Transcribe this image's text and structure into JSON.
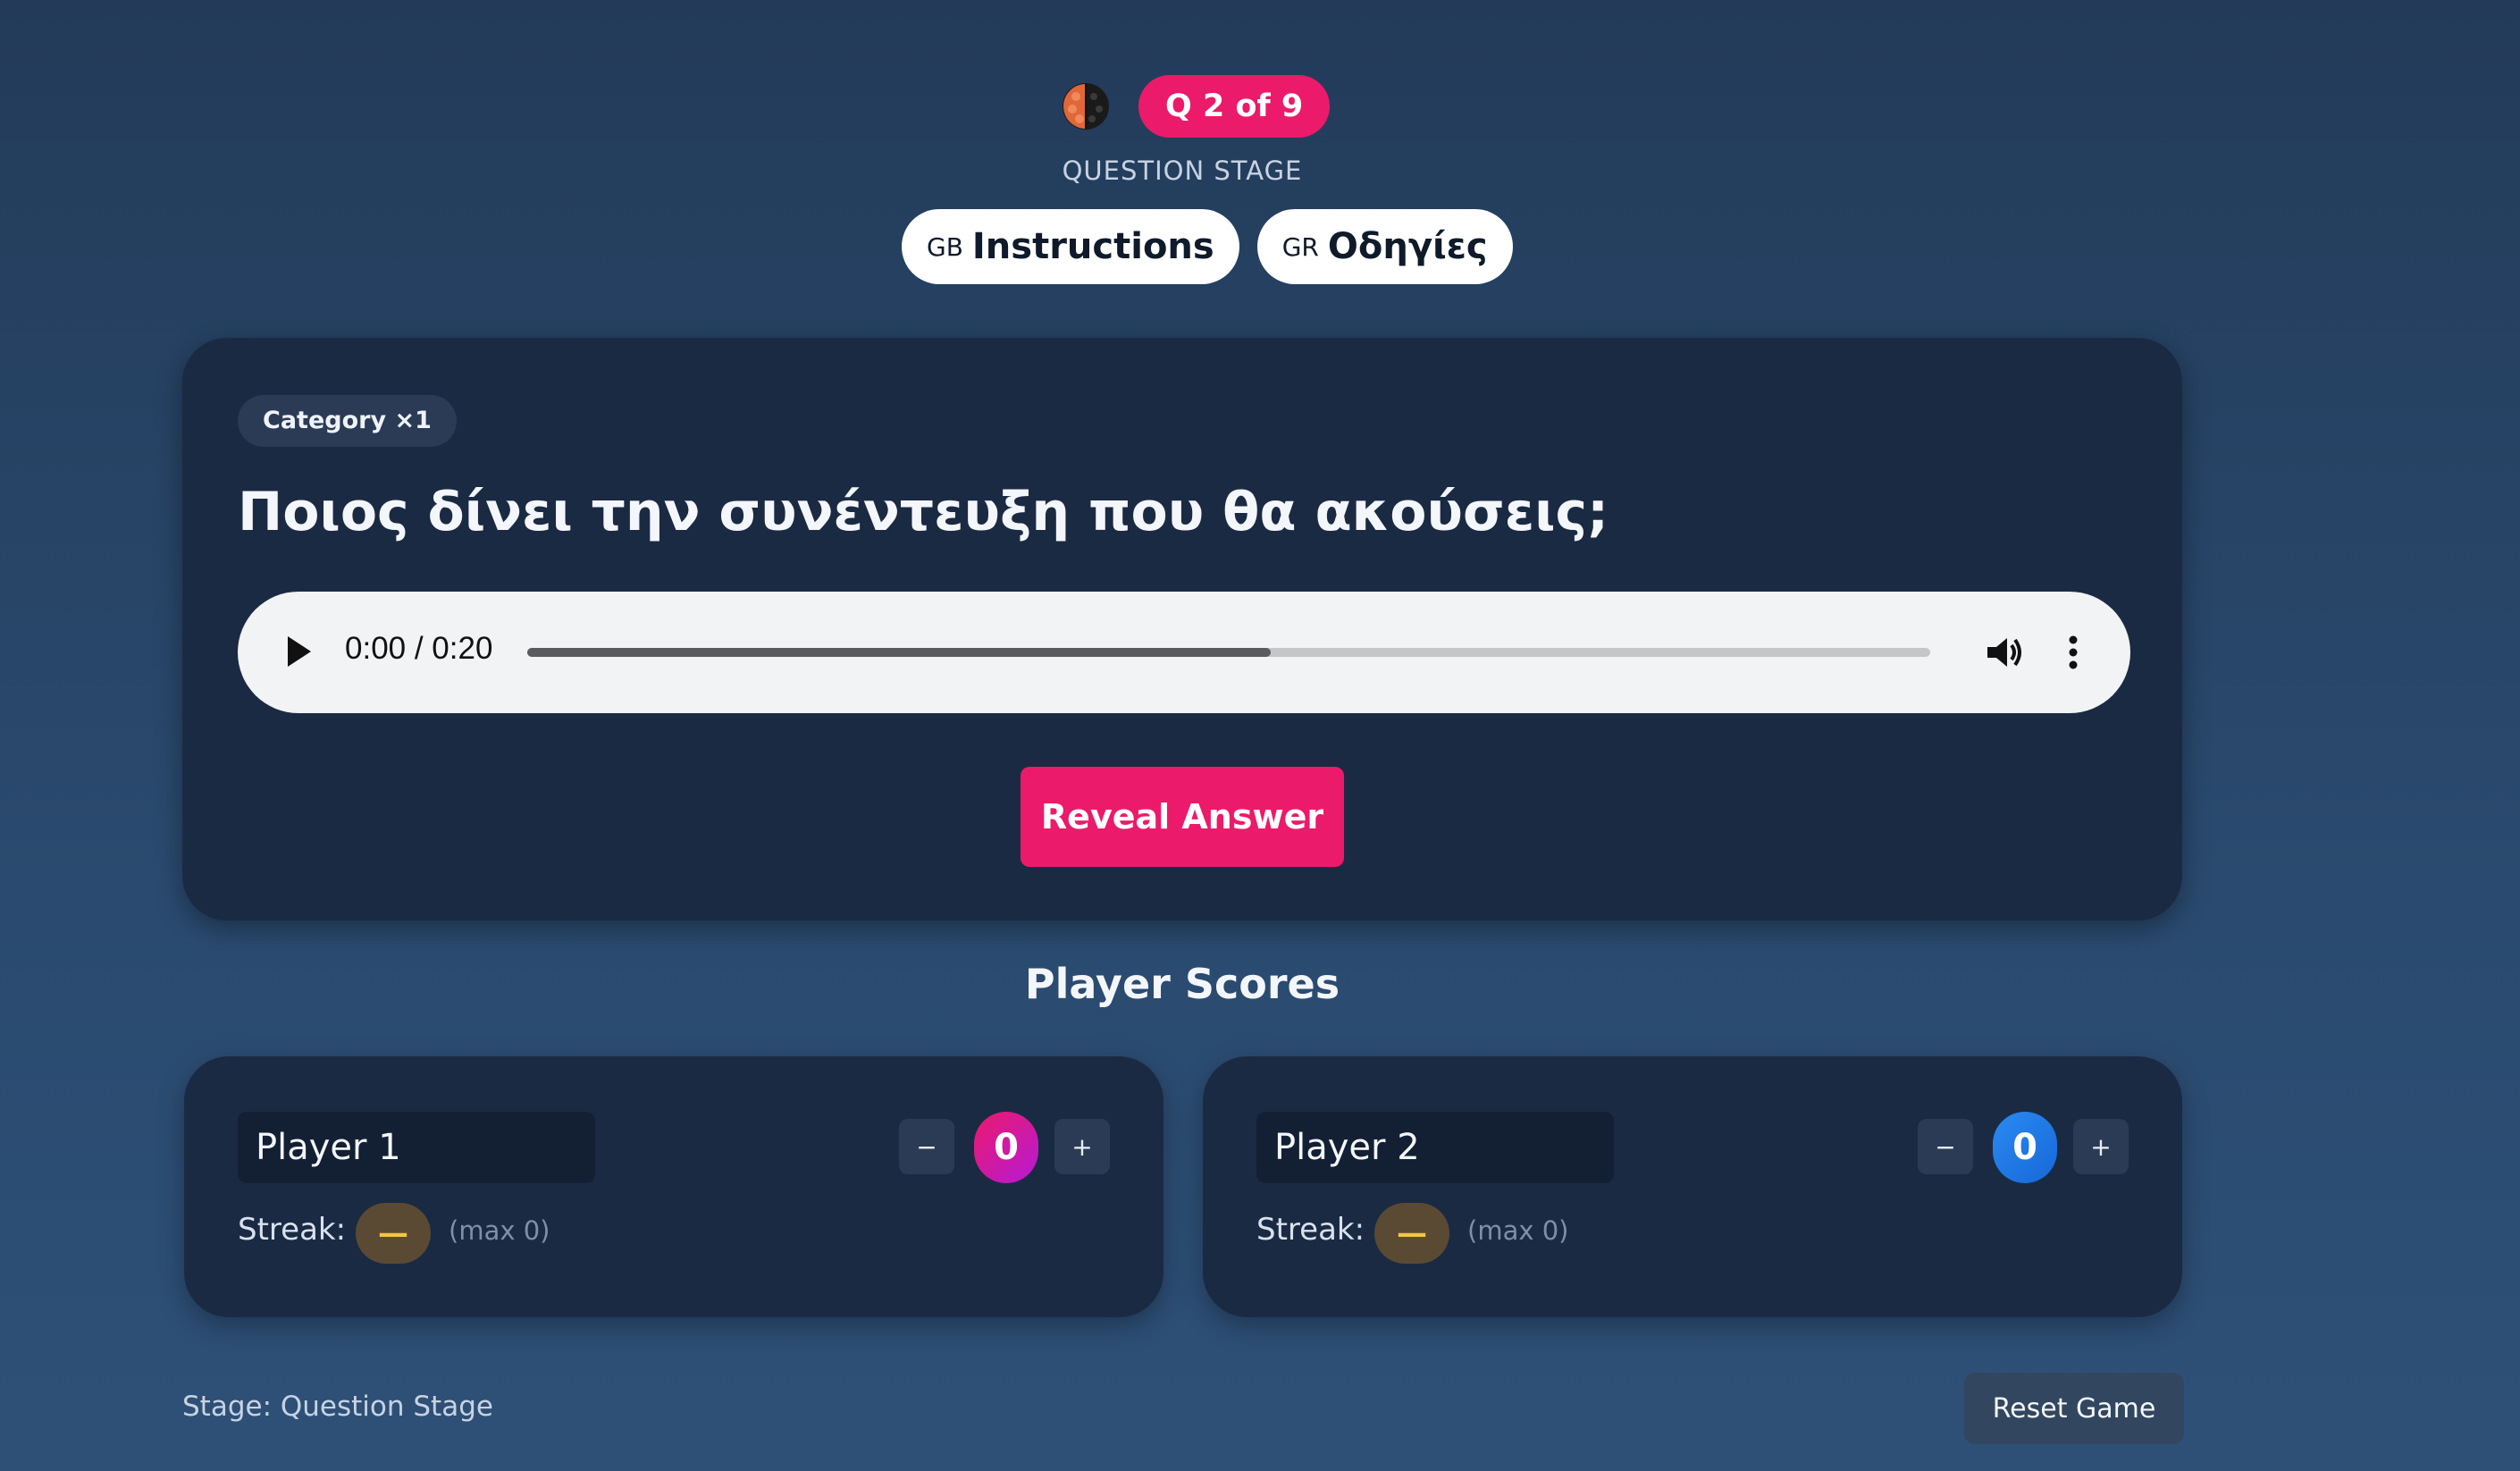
{
  "header": {
    "question_badge": "Q 2 of 9",
    "stage_label": "QUESTION STAGE",
    "icon": "brain-icon"
  },
  "language_buttons": [
    {
      "code": "GB",
      "label": "Instructions"
    },
    {
      "code": "GR",
      "label": "Οδηγίες"
    }
  ],
  "question_card": {
    "category": "Category ×1",
    "question": "Ποιος δίνει την συνέντευξη που θα ακούσεις;",
    "audio": {
      "time": "0:00 / 0:20",
      "buffered_fraction": 0.53
    },
    "reveal_label": "Reveal Answer"
  },
  "scores": {
    "title": "Player Scores",
    "players": [
      {
        "name": "Player 1",
        "score": "0",
        "minus": "−",
        "plus": "+",
        "streak_label": "Streak:",
        "streak_value": "—",
        "streak_max": "(max 0)"
      },
      {
        "name": "Player 2",
        "score": "0",
        "minus": "−",
        "plus": "+",
        "streak_label": "Streak:",
        "streak_value": "—",
        "streak_max": "(max 0)"
      }
    ]
  },
  "footer": {
    "stage_text": "Stage: Question Stage",
    "reset_label": "Reset Game"
  },
  "colors": {
    "accent": "#ec1a6a",
    "card": "#1b2a43",
    "player1": "#b41ad8",
    "player2": "#1668d8"
  }
}
